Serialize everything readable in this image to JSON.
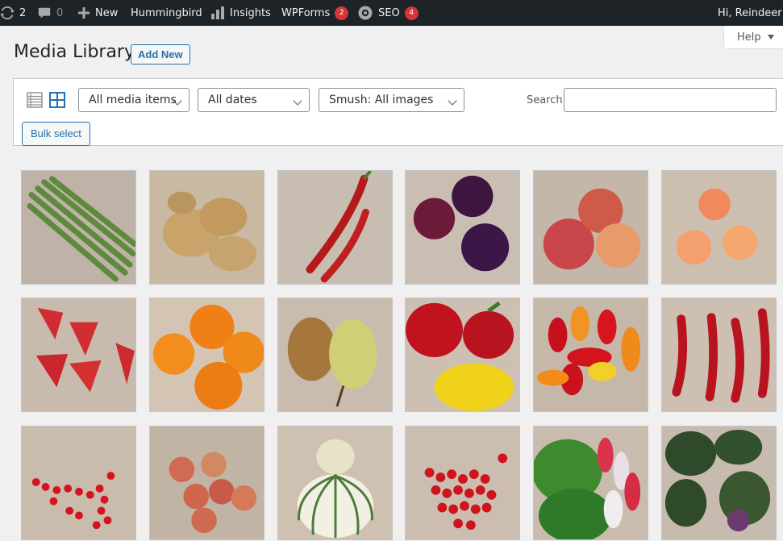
{
  "adminbar": {
    "updates_count": "2",
    "comments_count": "0",
    "new_label": "New",
    "hummingbird_label": "Hummingbird",
    "insights_label": "Insights",
    "wpforms_label": "WPForms",
    "wpforms_badge": "2",
    "seo_label": "SEO",
    "seo_badge": "4",
    "greeting": "Hi, Reindeer"
  },
  "help_label": "Help",
  "page": {
    "title": "Media Library",
    "add_new_label": "Add New"
  },
  "toolbar": {
    "media_filter": "All media items",
    "date_filter": "All dates",
    "smush_filter": "Smush: All images",
    "search_label": "Search",
    "search_value": "",
    "bulk_select_label": "Bulk select"
  },
  "colors": {
    "adminbar_bg": "#1d2327",
    "accent": "#2271b1",
    "badge": "#d63638",
    "page_bg": "#f0f0f1"
  },
  "media_items": [
    {
      "name": "asparagus"
    },
    {
      "name": "ginger"
    },
    {
      "name": "red-chili-peppers"
    },
    {
      "name": "plums"
    },
    {
      "name": "nectarines"
    },
    {
      "name": "apricots"
    },
    {
      "name": "strawberries"
    },
    {
      "name": "mandarins"
    },
    {
      "name": "pears"
    },
    {
      "name": "bell-peppers"
    },
    {
      "name": "mini-peppers"
    },
    {
      "name": "red-chilies"
    },
    {
      "name": "redcurrants"
    },
    {
      "name": "apples"
    },
    {
      "name": "squash"
    },
    {
      "name": "redcurrant-berries"
    },
    {
      "name": "radishes"
    },
    {
      "name": "kohlrabi"
    }
  ]
}
